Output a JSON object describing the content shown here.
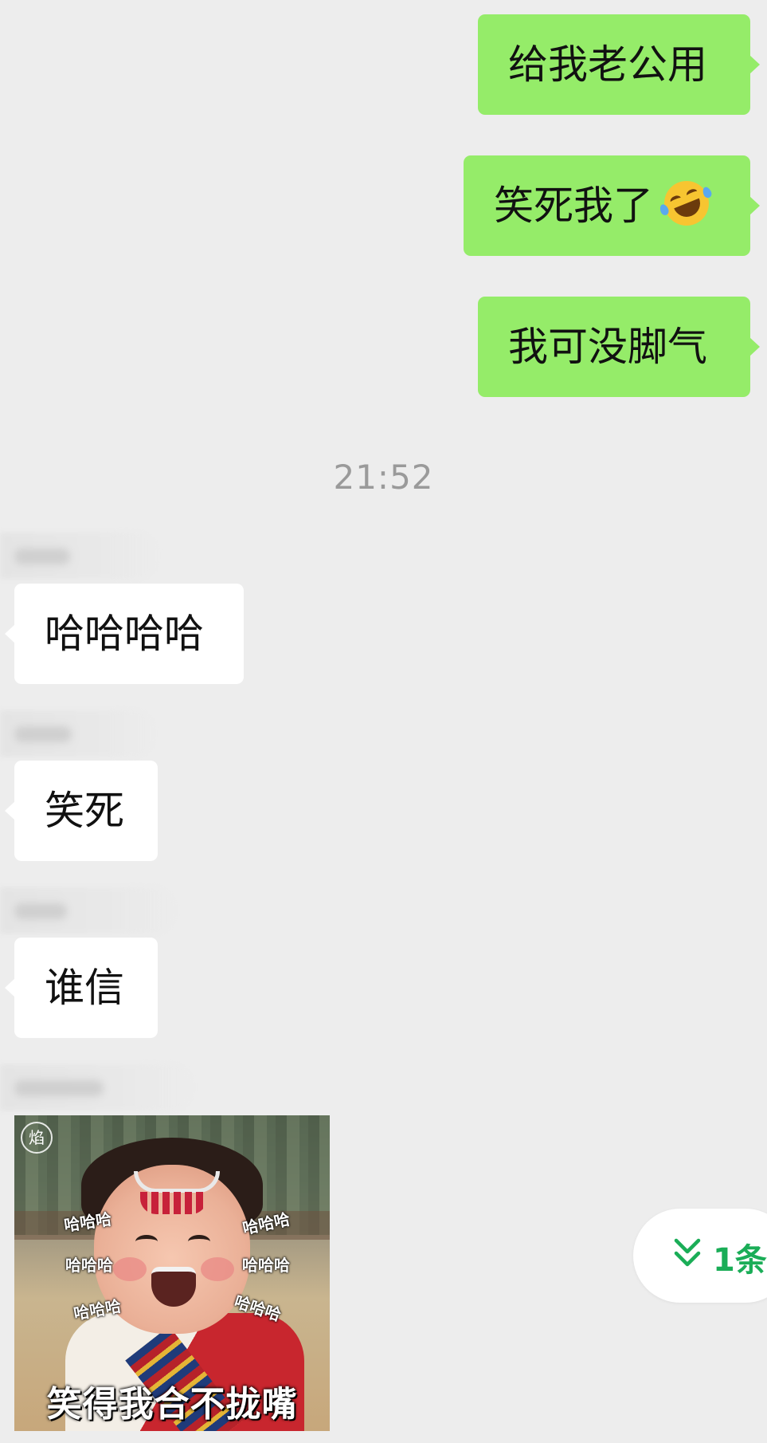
{
  "messages_out": [
    {
      "text": "给我老公用"
    },
    {
      "text": "笑死我了",
      "emoji": "rolling-on-floor-laughing-emoji"
    },
    {
      "text": "我可没脚气"
    }
  ],
  "timestamp": "21:52",
  "messages_in": [
    {
      "text": "哈哈哈哈"
    },
    {
      "text": "笑死"
    },
    {
      "text": "谁信"
    }
  ],
  "sticker": {
    "caption": "笑得我合不拢嘴",
    "overlay_text": "哈哈哈",
    "logo_glyph": "焰"
  },
  "new_messages_pill": {
    "label": "1条",
    "icon": "double-chevron-down-icon",
    "color": "#1aad57"
  },
  "colors": {
    "background": "#ededed",
    "bubble_out": "#95ec69",
    "bubble_in": "#ffffff",
    "timestamp": "#9a9a9a"
  }
}
